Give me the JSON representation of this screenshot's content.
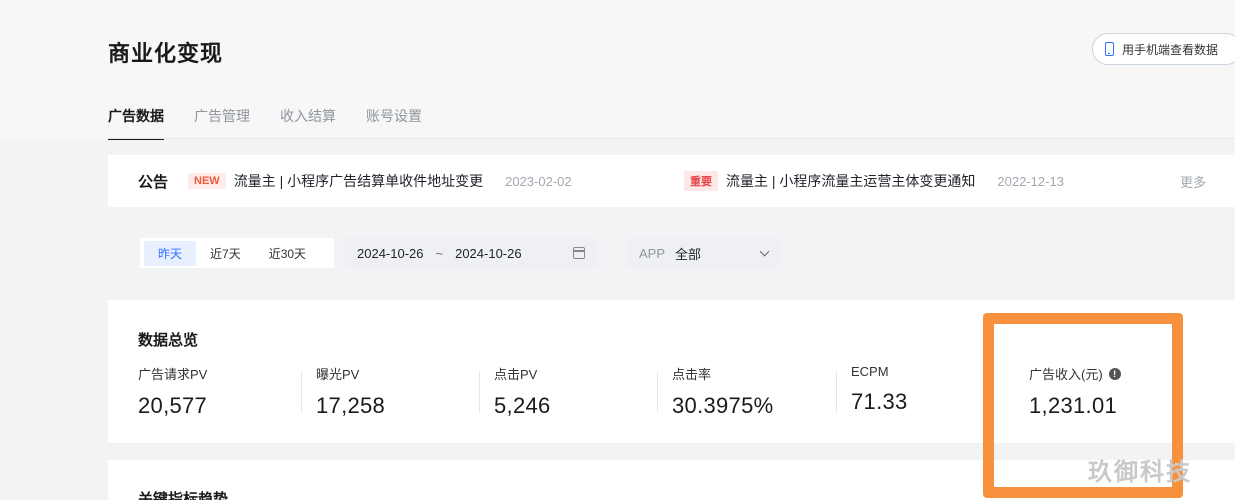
{
  "page": {
    "title": "商业化变现"
  },
  "header": {
    "mobile_button_label": "用手机端查看数据"
  },
  "tabs": [
    {
      "label": "广告数据",
      "active": true
    },
    {
      "label": "广告管理",
      "active": false
    },
    {
      "label": "收入结算",
      "active": false
    },
    {
      "label": "账号设置",
      "active": false
    }
  ],
  "notice": {
    "label": "公告",
    "items": [
      {
        "badge": "NEW",
        "title": "流量主 | 小程序广告结算单收件地址变更",
        "date": "2023-02-02"
      },
      {
        "badge": "重要",
        "title": "流量主 | 小程序流量主运营主体变更通知",
        "date": "2022-12-13"
      }
    ],
    "more": "更多"
  },
  "filters": {
    "date_tabs": [
      {
        "label": "昨天",
        "active": true
      },
      {
        "label": "近7天",
        "active": false
      },
      {
        "label": "近30天",
        "active": false
      }
    ],
    "start_date": "2024-10-26",
    "range_separator": "~",
    "end_date": "2024-10-26",
    "app_label": "APP",
    "app_value": "全部"
  },
  "overview": {
    "title": "数据总览",
    "metrics": [
      {
        "label": "广告请求PV",
        "value": "20,577"
      },
      {
        "label": "曝光PV",
        "value": "17,258"
      },
      {
        "label": "点击PV",
        "value": "5,246"
      },
      {
        "label": "点击率",
        "value": "30.3975%"
      },
      {
        "label": "ECPM",
        "value": "71.33"
      },
      {
        "label": "广告收入(元)",
        "value": "1,231.01"
      }
    ]
  },
  "trend": {
    "title": "关键指标趋势"
  },
  "colors": {
    "accent": "#3370ff",
    "highlight": "#f7913d"
  },
  "watermark": "玖御科技"
}
